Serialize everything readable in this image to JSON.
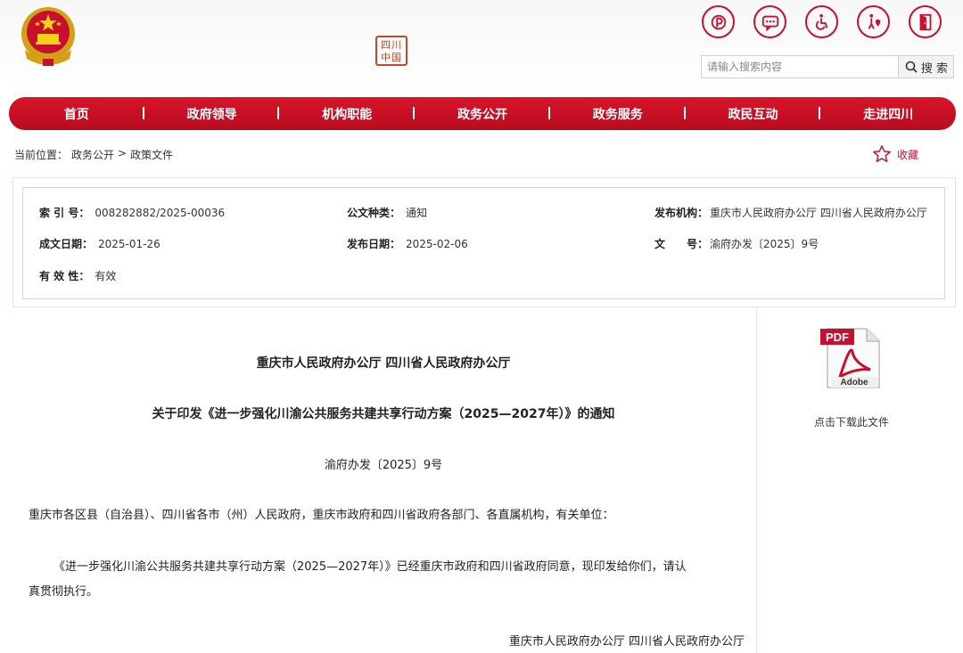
{
  "header": {
    "seal_text": "四川中国",
    "tools": [
      {
        "name": "mobile-icon"
      },
      {
        "name": "message-icon"
      },
      {
        "name": "accessibility-icon"
      },
      {
        "name": "elderly-care-icon"
      },
      {
        "name": "exit-icon"
      }
    ],
    "search": {
      "placeholder": "请输入搜索内容",
      "button_label": "搜 索"
    }
  },
  "nav": {
    "items": [
      "首页",
      "政府领导",
      "机构职能",
      "政务公开",
      "政务服务",
      "政民互动",
      "走进四川"
    ]
  },
  "breadcrumb": {
    "prefix": "当前位置：",
    "items": [
      "政务公开",
      "政策文件"
    ],
    "separator": ">"
  },
  "favorite": {
    "label": "收藏"
  },
  "meta": {
    "index_label": "索 引 号：",
    "index_value": "008282882/2025-00036",
    "type_label": "公文种类：",
    "type_value": "通知",
    "issuer_label": "发布机构：",
    "issuer_value": "重庆市人民政府办公厅 四川省人民政府办公厅",
    "date_created_label": "成文日期：",
    "date_created_value": "2025-01-26",
    "date_published_label": "发布日期：",
    "date_published_value": "2025-02-06",
    "doc_no_label": "文　　号：",
    "doc_no_value": "渝府办发〔2025〕9号",
    "validity_label": "有 效 性：",
    "validity_value": "有效"
  },
  "side": {
    "download_label": "点击下载此文件"
  },
  "document": {
    "issuer": "重庆市人民政府办公厅  四川省人民政府办公厅",
    "title": "关于印发《进一步强化川渝公共服务共建共享行动方案（2025—2027年）》的通知",
    "doc_no": "渝府办发〔2025〕9号",
    "salutation": "重庆市各区县（自治县）、四川省各市（州）人民政府，重庆市政府和四川省政府各部门、各直属机构，有关单位：",
    "body_line1": "《进一步强化川渝公共服务共建共享行动方案（2025—2027年）》已经重庆市政府和四川省政府同意，现印发给你们，请认",
    "body_line2": "真贯彻执行。",
    "signature": "重庆市人民政府办公厅    四川省人民政府办公厅"
  }
}
